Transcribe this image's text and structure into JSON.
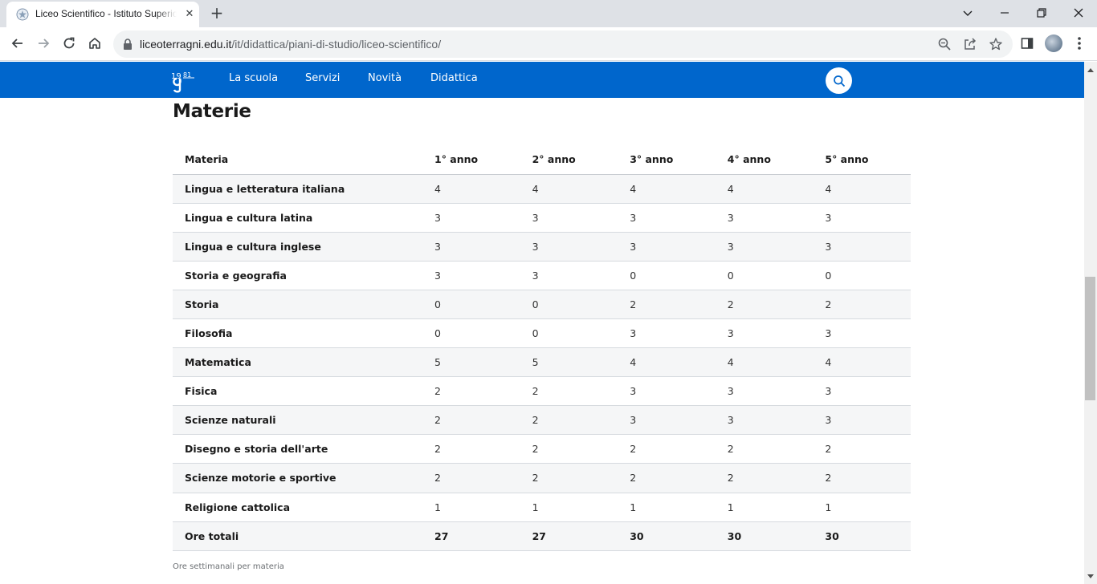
{
  "browser": {
    "tab_title": "Liceo Scientifico - Istituto Superiore",
    "tab_close_glyph": "✕",
    "new_tab_glyph": "+",
    "url_host": "liceoterragni.edu.it",
    "url_path": "/it/didattica/piani-di-studio/liceo-scientifico/",
    "icons": [
      "back-icon",
      "forward-icon",
      "reload-icon",
      "home-icon",
      "lock-icon",
      "zoom-icon",
      "share-icon",
      "bookmark-star-icon",
      "side-panel-icon",
      "profile-avatar",
      "menu-dots-icon"
    ]
  },
  "window_controls": {
    "minimize": "—",
    "restore": "❐",
    "close": "✕"
  },
  "site": {
    "nav": [
      "La scuola",
      "Servizi",
      "Novità",
      "Didattica"
    ],
    "brand_color": "#0066cc"
  },
  "content": {
    "section_title": "Materie",
    "table": {
      "headers": [
        "Materia",
        "1° anno",
        "2° anno",
        "3° anno",
        "4° anno",
        "5° anno"
      ],
      "rows": [
        {
          "subject": "Lingua e letteratura italiana",
          "hours": [
            "4",
            "4",
            "4",
            "4",
            "4"
          ]
        },
        {
          "subject": "Lingua e cultura latina",
          "hours": [
            "3",
            "3",
            "3",
            "3",
            "3"
          ]
        },
        {
          "subject": "Lingua e cultura inglese",
          "hours": [
            "3",
            "3",
            "3",
            "3",
            "3"
          ]
        },
        {
          "subject": "Storia e geografia",
          "hours": [
            "3",
            "3",
            "0",
            "0",
            "0"
          ]
        },
        {
          "subject": "Storia",
          "hours": [
            "0",
            "0",
            "2",
            "2",
            "2"
          ]
        },
        {
          "subject": "Filosofia",
          "hours": [
            "0",
            "0",
            "3",
            "3",
            "3"
          ]
        },
        {
          "subject": "Matematica",
          "hours": [
            "5",
            "5",
            "4",
            "4",
            "4"
          ]
        },
        {
          "subject": "Fisica",
          "hours": [
            "2",
            "2",
            "3",
            "3",
            "3"
          ]
        },
        {
          "subject": "Scienze naturali",
          "hours": [
            "2",
            "2",
            "3",
            "3",
            "3"
          ]
        },
        {
          "subject": "Disegno e storia dell'arte",
          "hours": [
            "2",
            "2",
            "2",
            "2",
            "2"
          ]
        },
        {
          "subject": "Scienze motorie e sportive",
          "hours": [
            "2",
            "2",
            "2",
            "2",
            "2"
          ]
        },
        {
          "subject": "Religione cattolica",
          "hours": [
            "1",
            "1",
            "1",
            "1",
            "1"
          ]
        }
      ],
      "total": {
        "subject": "Ore totali",
        "hours": [
          "27",
          "27",
          "30",
          "30",
          "30"
        ]
      }
    },
    "caption": "Ore settimanali per materia"
  }
}
